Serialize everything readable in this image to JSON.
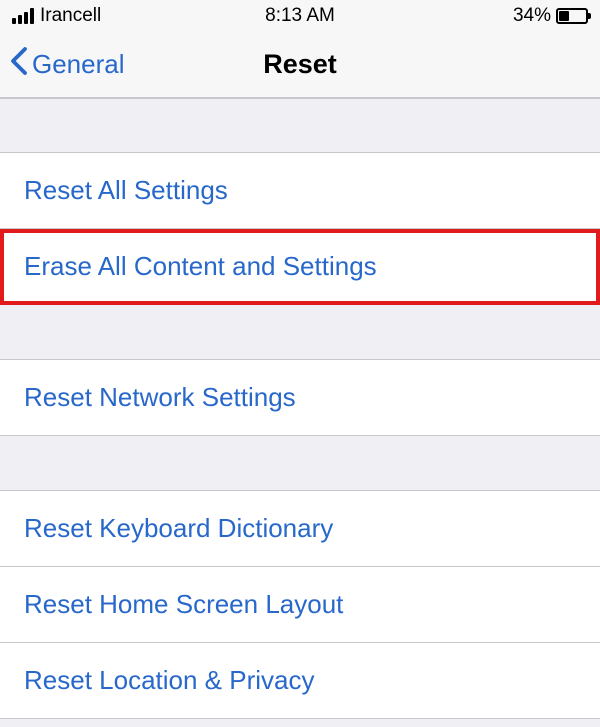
{
  "status": {
    "carrier": "Irancell",
    "time": "8:13 AM",
    "battery_percent": "34%"
  },
  "nav": {
    "back_label": "General",
    "title": "Reset"
  },
  "items": {
    "reset_all": "Reset All Settings",
    "erase_all": "Erase All Content and Settings",
    "reset_network": "Reset Network Settings",
    "reset_keyboard": "Reset Keyboard Dictionary",
    "reset_home": "Reset Home Screen Layout",
    "reset_location": "Reset Location & Privacy"
  }
}
